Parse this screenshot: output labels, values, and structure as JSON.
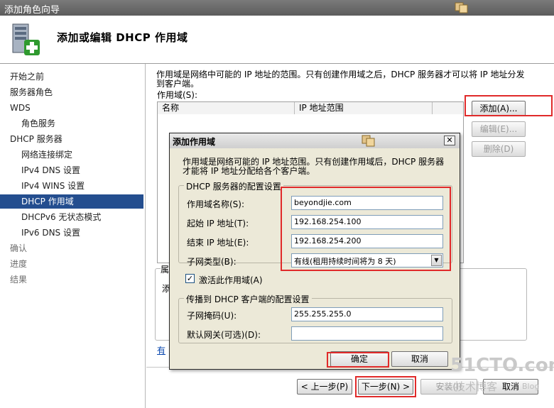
{
  "window": {
    "title": "添加角色向导"
  },
  "header": {
    "title": "添加或编辑 DHCP 作用域"
  },
  "nav": {
    "items": [
      {
        "label": "开始之前",
        "state": "normal"
      },
      {
        "label": "服务器角色",
        "state": "normal"
      },
      {
        "label": "WDS",
        "state": "normal"
      },
      {
        "label": "角色服务",
        "state": "sub"
      },
      {
        "label": "DHCP 服务器",
        "state": "normal"
      },
      {
        "label": "网络连接绑定",
        "state": "sub"
      },
      {
        "label": "IPv4 DNS 设置",
        "state": "sub"
      },
      {
        "label": "IPv4 WINS 设置",
        "state": "sub"
      },
      {
        "label": "DHCP 作用域",
        "state": "selected"
      },
      {
        "label": "DHCPv6 无状态模式",
        "state": "sub"
      },
      {
        "label": "IPv6 DNS 设置",
        "state": "sub"
      },
      {
        "label": "确认",
        "state": "disabled"
      },
      {
        "label": "进度",
        "state": "disabled"
      },
      {
        "label": "结果",
        "state": "disabled"
      }
    ]
  },
  "content": {
    "description": "作用域是网络中可能的 IP 地址的范围。只有创建作用域之后，DHCP 服务器才可以将 IP 地址分发到客户端。",
    "scope_label": "作用域(S):",
    "columns": [
      "名称",
      "IP 地址范围"
    ],
    "add_button": "添加(A)...",
    "edit_button": "编辑(E)...",
    "delete_button": "删除(D)",
    "partial_label_1": "属",
    "partial_label_2": "添",
    "partial_link": "有"
  },
  "dialog": {
    "title": "添加作用域",
    "description": "作用域是网络可能的 IP 地址范围。只有创建作用域后，DHCP 服务器才能将 IP 地址分配给各个客户端。",
    "group1": "DHCP 服务器的配置设置",
    "scope_name_label": "作用域名称(S):",
    "scope_name_value": "beyondjie.com",
    "start_ip_label": "起始 IP 地址(T):",
    "start_ip_value": "192.168.254.100",
    "end_ip_label": "结束 IP 地址(E):",
    "end_ip_value": "192.168.254.200",
    "subnet_type_label": "子网类型(B):",
    "subnet_type_value": "有线(租用持续时间将为 8 天)",
    "activate_label": "激活此作用域(A)",
    "activate_checked": true,
    "group2": "传播到 DHCP 客户端的配置设置",
    "subnet_mask_label": "子网掩码(U):",
    "subnet_mask_value": "255.255.255.0",
    "gateway_label": "默认网关(可选)(D):",
    "gateway_value": "",
    "ok_button": "确定",
    "cancel_button": "取消"
  },
  "footer": {
    "prev_button": "< 上一步(P)",
    "next_button": "下一步(N) >",
    "install_button": "安装(I)",
    "cancel_button": "取消"
  },
  "watermark": {
    "main": "51CTO.com",
    "sub": "技术博客",
    "extra": "Blog"
  },
  "colors": {
    "selection": "#244e8f",
    "highlight_box": "#e02a2a",
    "dialog_bg": "#ece9d8"
  }
}
